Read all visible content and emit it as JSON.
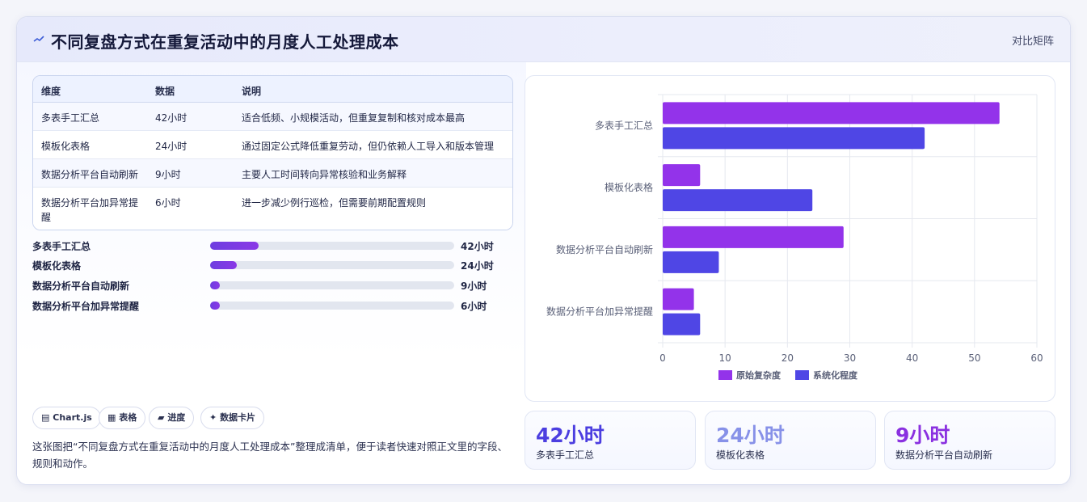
{
  "header": {
    "title": "不同复盘方式在重复活动中的月度人工处理成本",
    "tag": "对比矩阵"
  },
  "table": {
    "columns": [
      "维度",
      "数据",
      "说明"
    ],
    "rows": [
      [
        "多表手工汇总",
        "42小时",
        "适合低频、小规模活动，但重复复制和核对成本最高"
      ],
      [
        "模板化表格",
        "24小时",
        "通过固定公式降低重复劳动，但仍依赖人工导入和版本管理"
      ],
      [
        "数据分析平台自动刷新",
        "9小时",
        "主要人工时间转向异常核验和业务解释"
      ],
      [
        "数据分析平台加异常提醒",
        "6小时",
        "进一步减少例行巡检，但需要前期配置规则"
      ]
    ]
  },
  "progress": {
    "max": 42,
    "items": [
      {
        "label": "多表手工汇总",
        "value": 42,
        "display": "42小时",
        "fill_pct": 20
      },
      {
        "label": "模板化表格",
        "value": 24,
        "display": "24小时",
        "fill_pct": 11
      },
      {
        "label": "数据分析平台自动刷新",
        "value": 9,
        "display": "9小时",
        "fill_pct": 4
      },
      {
        "label": "数据分析平台加异常提醒",
        "value": 6,
        "display": "6小时",
        "fill_pct": 4
      }
    ]
  },
  "chips": [
    {
      "icon": "chart-icon",
      "glyph": "▤",
      "label": "Chart.js"
    },
    {
      "icon": "table-icon",
      "glyph": "▦",
      "label": "表格"
    },
    {
      "icon": "folder-icon",
      "glyph": "▰",
      "label": "进度"
    },
    {
      "icon": "sparkle-icon",
      "glyph": "✦",
      "label": "数据卡片"
    }
  ],
  "description": "这张图把“不同复盘方式在重复活动中的月度人工处理成本”整理成清单，便于读者快速对照正文里的字段、规则和动作。",
  "stats": [
    {
      "value": "42小时",
      "label": "多表手工汇总",
      "color": "#4b3ee0"
    },
    {
      "value": "24小时",
      "label": "模板化表格",
      "color": "#8791e8"
    },
    {
      "value": "9小时",
      "label": "数据分析平台自动刷新",
      "color": "#8a30e0"
    }
  ],
  "chart_data": {
    "type": "bar",
    "orientation": "horizontal",
    "categories": [
      "多表手工汇总",
      "模板化表格",
      "数据分析平台自动刷新",
      "数据分析平台加异常提醒"
    ],
    "series": [
      {
        "name": "原始复杂度",
        "values": [
          54,
          6,
          29,
          5
        ],
        "color": "#9333ea"
      },
      {
        "name": "系统化程度",
        "values": [
          42,
          24,
          9,
          6
        ],
        "color": "#4f46e5"
      }
    ],
    "xlim": [
      0,
      60
    ],
    "xticks": [
      0,
      10,
      20,
      30,
      40,
      50,
      60
    ],
    "grid": true,
    "legend_position": "bottom"
  }
}
